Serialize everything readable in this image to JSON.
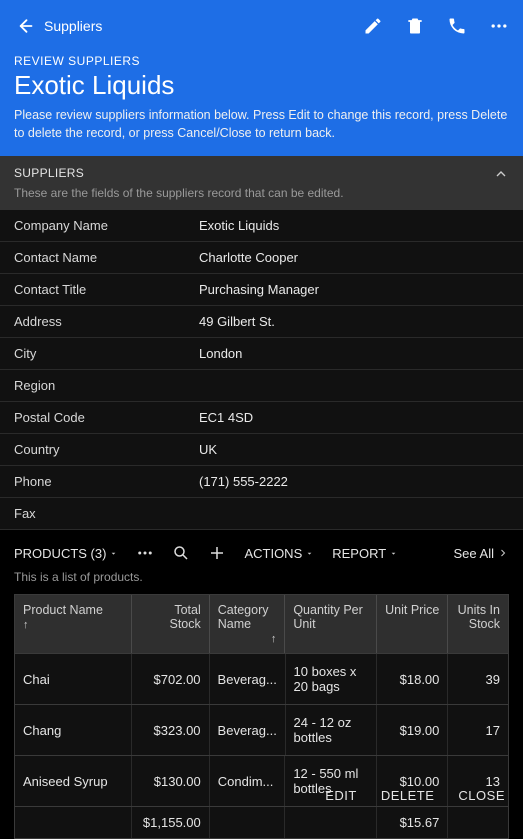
{
  "appbar": {
    "back_title": "Suppliers",
    "subheading": "REVIEW SUPPLIERS",
    "title": "Exotic Liquids",
    "description": "Please review suppliers information below. Press Edit to change this record, press Delete to delete the record, or press Cancel/Close to return back."
  },
  "section": {
    "label": "SUPPLIERS",
    "hint": "These are the fields of the suppliers record that can be edited."
  },
  "fields": [
    {
      "label": "Company Name",
      "value": "Exotic Liquids"
    },
    {
      "label": "Contact Name",
      "value": "Charlotte Cooper"
    },
    {
      "label": "Contact Title",
      "value": "Purchasing Manager"
    },
    {
      "label": "Address",
      "value": "49 Gilbert St."
    },
    {
      "label": "City",
      "value": "London"
    },
    {
      "label": "Region",
      "value": ""
    },
    {
      "label": "Postal Code",
      "value": "EC1 4SD"
    },
    {
      "label": "Country",
      "value": "UK"
    },
    {
      "label": "Phone",
      "value": "(171) 555-2222"
    },
    {
      "label": "Fax",
      "value": ""
    }
  ],
  "products_bar": {
    "title": "PRODUCTS (3)",
    "actions": "ACTIONS",
    "report": "REPORT",
    "see_all": "See All"
  },
  "products_hint": "This is a list of products.",
  "grid_headers": {
    "product_name": "Product Name",
    "total_stock": "Total Stock",
    "category_name": "Category Name",
    "qty_per_unit": "Quantity Per Unit",
    "unit_price": "Unit Price",
    "units_in_stock": "Units In Stock"
  },
  "grid_rows": [
    {
      "name": "Chai",
      "total": "$702.00",
      "cat": "Beverag...",
      "qty": "10 boxes x 20 bags",
      "price": "$18.00",
      "stock": "39"
    },
    {
      "name": "Chang",
      "total": "$323.00",
      "cat": "Beverag...",
      "qty": "24 - 12 oz bottles",
      "price": "$19.00",
      "stock": "17"
    },
    {
      "name": "Aniseed Syrup",
      "total": "$130.00",
      "cat": "Condim...",
      "qty": "12 - 550 ml bottles",
      "price": "$10.00",
      "stock": "13"
    }
  ],
  "grid_footer": {
    "total": "$1,155.00",
    "price": "$15.67"
  },
  "bottom": {
    "edit": "EDIT",
    "delete": "DELETE",
    "close": "CLOSE"
  }
}
